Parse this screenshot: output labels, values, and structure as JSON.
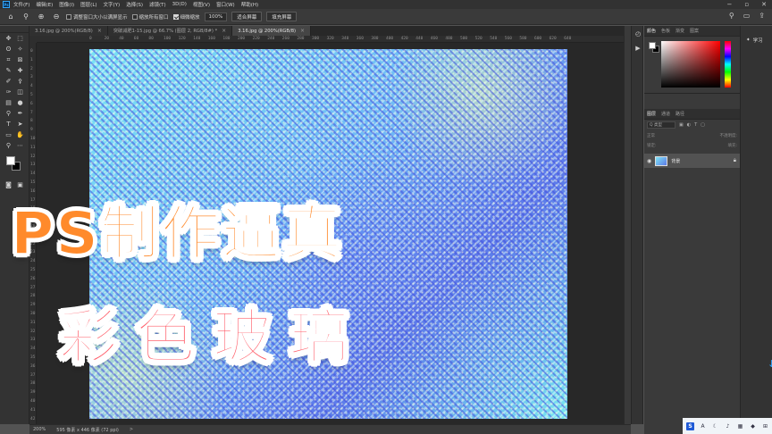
{
  "app": {
    "logo": "Ps"
  },
  "menu": [
    "文件(F)",
    "编辑(E)",
    "图像(I)",
    "图层(L)",
    "文字(Y)",
    "选择(S)",
    "滤镜(T)",
    "3D(D)",
    "视图(V)",
    "窗口(W)",
    "帮助(H)"
  ],
  "options": {
    "resize_windows_label": "调整窗口大小以满屏显示",
    "resize_windows_checked": false,
    "zoom_all_label": "缩放所有窗口",
    "zoom_all_checked": false,
    "scrubby_zoom_label": "细微缩放",
    "scrubby_zoom_checked": true,
    "zoom_value": "100%",
    "fit_screen_label": "适合屏幕",
    "fill_screen_label": "填充屏幕"
  },
  "tabs": [
    {
      "label": "3.16.jpg @ 200%(RGB/8)",
      "active": false
    },
    {
      "label": "突破减肥1-15.jpg @ 66.7% (图层 2, RGB/8#) *",
      "active": false
    },
    {
      "label": "3.16.jpg @ 200%(RGB/8)",
      "active": true
    }
  ],
  "ruler": {
    "h_ticks": [
      "0",
      "20",
      "40",
      "60",
      "80",
      "100",
      "120",
      "140",
      "160",
      "180",
      "200",
      "220",
      "240",
      "260",
      "280",
      "300",
      "320",
      "340",
      "360",
      "380",
      "400",
      "420",
      "440",
      "460",
      "480",
      "500",
      "520",
      "540",
      "560",
      "580",
      "600",
      "620",
      "640"
    ],
    "v_ticks": [
      "0",
      "1",
      "2",
      "3",
      "4",
      "5",
      "6",
      "7",
      "8",
      "9",
      "10",
      "11",
      "12",
      "13",
      "14",
      "15",
      "16",
      "17",
      "18",
      "19",
      "20",
      "21",
      "22",
      "23",
      "24",
      "25",
      "26",
      "27",
      "28",
      "29",
      "30",
      "31",
      "32",
      "33",
      "34",
      "35",
      "36",
      "37",
      "38",
      "39",
      "40",
      "41",
      "42"
    ]
  },
  "overlay": {
    "title_line1": "PS制作逼真",
    "title_line2": "彩色玻璃"
  },
  "status": {
    "zoom": "200%",
    "doc_info": "595 像素 x 446 像素 (72 ppi)",
    "arrow": ">"
  },
  "panels": {
    "color_tabs": [
      "颜色",
      "色板",
      "渐变",
      "图案"
    ],
    "layer_tabs": [
      "图层",
      "通道",
      "路径"
    ],
    "search_placeholder": "Q 类型",
    "blend_mode": "正常",
    "opacity_label": "不透明度:",
    "lock_label": "锁定:",
    "fill_label": "填充:",
    "layer_name": "背景"
  },
  "learn": {
    "label": "学习"
  },
  "colors": {
    "accent": "#31a8ff",
    "title1": "#ff8a2b",
    "title2": "#ff5a66"
  }
}
